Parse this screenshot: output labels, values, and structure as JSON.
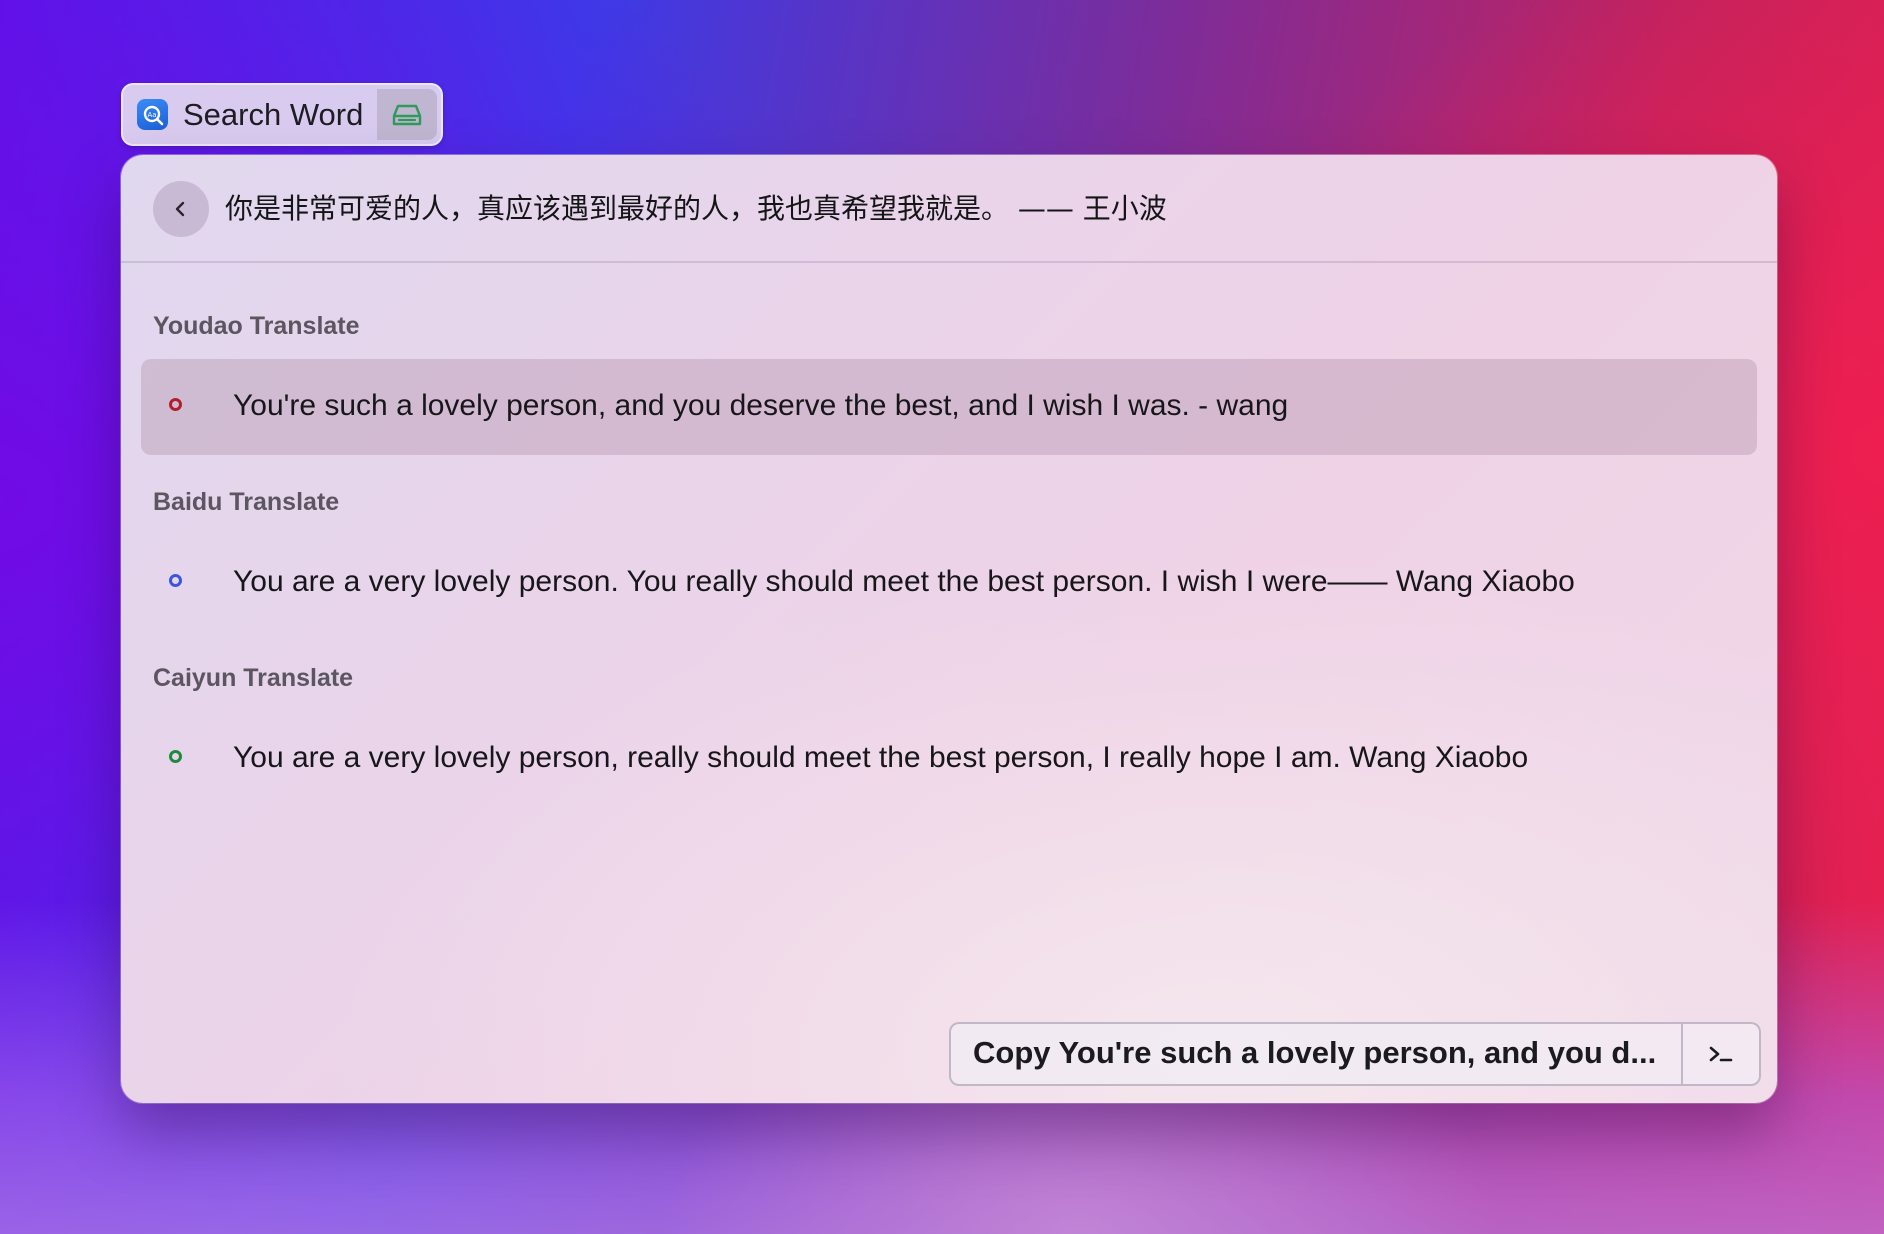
{
  "tag": {
    "title": "Search Word",
    "app_icon": "search-word-icon",
    "secondary_icon": "drive-icon"
  },
  "header": {
    "back_icon": "chevron-left-icon",
    "query": "你是非常可爱的人，真应该遇到最好的人，我也真希望我就是。 —— 王小波"
  },
  "sections": [
    {
      "title": "Youdao Translate",
      "dot_color": "#b0202a",
      "text": "You're such a lovely person, and you deserve the best, and I wish I was. - wang",
      "selected": true
    },
    {
      "title": "Baidu Translate",
      "dot_color": "#3a55e0",
      "text": "You are a very lovely person. You really should meet the best person. I wish I were—— Wang Xiaobo",
      "selected": false
    },
    {
      "title": "Caiyun Translate",
      "dot_color": "#1e8a3a",
      "text": "You are a very lovely person, really should meet the best person, I really hope I am. Wang Xiaobo",
      "selected": false
    }
  ],
  "action_bar": {
    "copy_label": "Copy  You're such a lovely person, and you d...",
    "terminal_icon": "terminal-icon"
  },
  "colors": {
    "tag_drive_icon": "#2f9a5a",
    "app_icon_bg": "#2a74e8"
  }
}
